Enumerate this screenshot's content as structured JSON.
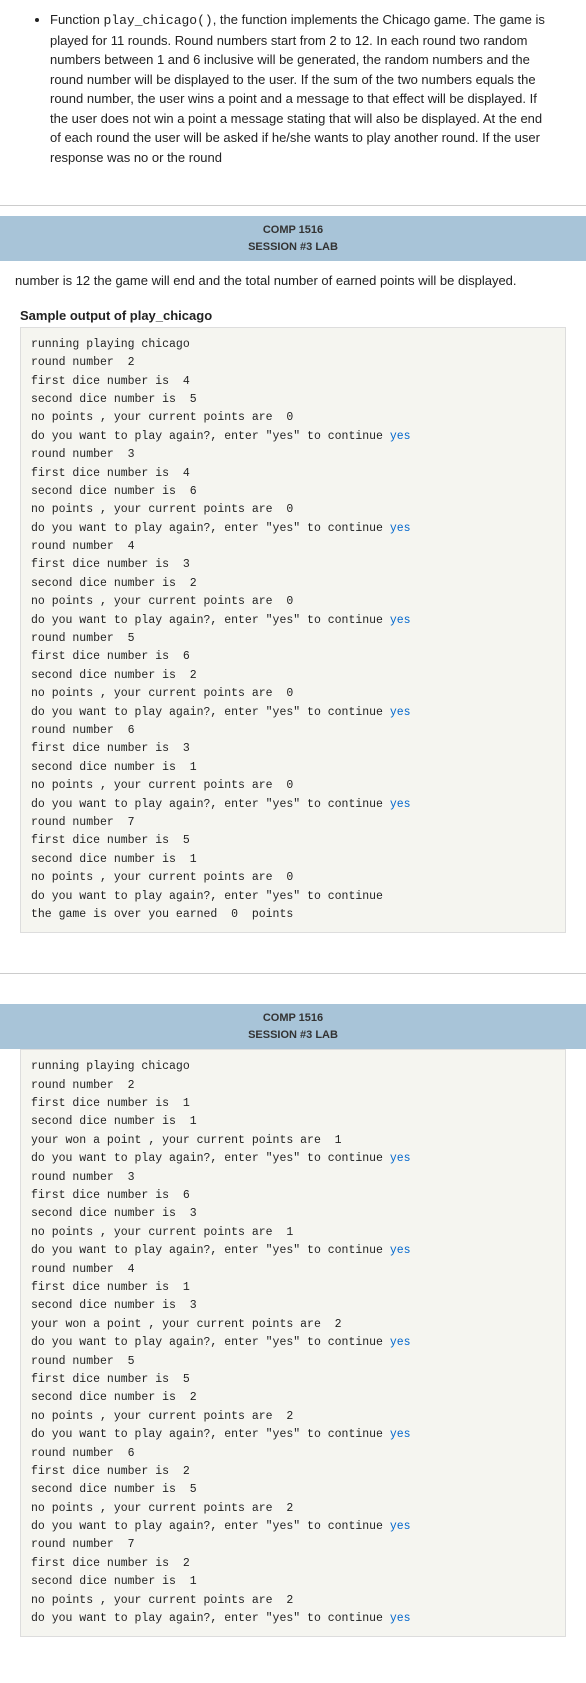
{
  "intro": {
    "bullet_text": "Function ",
    "function_name": "play_chicago()",
    "description": ", the function implements the Chicago game. The game is played for 11 rounds. Round numbers start from 2 to 12. In each round two random numbers between 1 and 6 inclusive will be generated, the random numbers and the round number will be displayed to the user. If the sum of the two numbers equals the round number, the user wins a point and a message to that effect will be displayed. If the user does not win a point a message stating that will also be displayed. At the end of each round the user will be asked if he/she wants to play another round. If the user response was no or the round"
  },
  "header1": {
    "line1": "COMP 1516",
    "line2": "SESSION #3 LAB"
  },
  "continuation": {
    "text": "number is 12 the game will end and the total number of earned points will be displayed."
  },
  "sample_label": "Sample output of play_chicago",
  "code_block1": {
    "lines": [
      {
        "text": "running playing chicago",
        "has_yes": false
      },
      {
        "text": "round number  2",
        "has_yes": false
      },
      {
        "text": "first dice number is  4",
        "has_yes": false
      },
      {
        "text": "second dice number is  5",
        "has_yes": false
      },
      {
        "text": "no points , your current points are  0",
        "has_yes": false
      },
      {
        "text": "do you want to play again?, enter \"yes\" to continue ",
        "has_yes": true,
        "yes_word": "yes"
      },
      {
        "text": "round number  3",
        "has_yes": false
      },
      {
        "text": "first dice number is  4",
        "has_yes": false
      },
      {
        "text": "second dice number is  6",
        "has_yes": false
      },
      {
        "text": "no points , your current points are  0",
        "has_yes": false
      },
      {
        "text": "do you want to play again?, enter \"yes\" to continue ",
        "has_yes": true,
        "yes_word": "yes"
      },
      {
        "text": "round number  4",
        "has_yes": false
      },
      {
        "text": "first dice number is  3",
        "has_yes": false
      },
      {
        "text": "second dice number is  2",
        "has_yes": false
      },
      {
        "text": "no points , your current points are  0",
        "has_yes": false
      },
      {
        "text": "do you want to play again?, enter \"yes\" to continue ",
        "has_yes": true,
        "yes_word": "yes"
      },
      {
        "text": "round number  5",
        "has_yes": false
      },
      {
        "text": "first dice number is  6",
        "has_yes": false
      },
      {
        "text": "second dice number is  2",
        "has_yes": false
      },
      {
        "text": "no points , your current points are  0",
        "has_yes": false
      },
      {
        "text": "do you want to play again?, enter \"yes\" to continue ",
        "has_yes": true,
        "yes_word": "yes"
      },
      {
        "text": "round number  6",
        "has_yes": false
      },
      {
        "text": "first dice number is  3",
        "has_yes": false
      },
      {
        "text": "second dice number is  1",
        "has_yes": false
      },
      {
        "text": "no points , your current points are  0",
        "has_yes": false
      },
      {
        "text": "do you want to play again?, enter \"yes\" to continue ",
        "has_yes": true,
        "yes_word": "yes"
      },
      {
        "text": "round number  7",
        "has_yes": false
      },
      {
        "text": "first dice number is  5",
        "has_yes": false
      },
      {
        "text": "second dice number is  1",
        "has_yes": false
      },
      {
        "text": "no points , your current points are  0",
        "has_yes": false
      },
      {
        "text": "do you want to play again?, enter \"yes\" to continue",
        "has_yes": false
      },
      {
        "text": "the game is over you earned  0  points",
        "has_yes": false
      }
    ]
  },
  "header2": {
    "line1": "COMP 1516",
    "line2": "SESSION #3 LAB"
  },
  "code_block2": {
    "lines": [
      {
        "text": "running playing chicago",
        "has_yes": false
      },
      {
        "text": "round number  2",
        "has_yes": false
      },
      {
        "text": "first dice number is  1",
        "has_yes": false
      },
      {
        "text": "second dice number is  1",
        "has_yes": false
      },
      {
        "text": "your won a point , your current points are  1",
        "has_yes": false
      },
      {
        "text": "do you want to play again?, enter \"yes\" to continue ",
        "has_yes": true,
        "yes_word": "yes"
      },
      {
        "text": "round number  3",
        "has_yes": false
      },
      {
        "text": "first dice number is  6",
        "has_yes": false
      },
      {
        "text": "second dice number is  3",
        "has_yes": false
      },
      {
        "text": "no points , your current points are  1",
        "has_yes": false
      },
      {
        "text": "do you want to play again?, enter \"yes\" to continue ",
        "has_yes": true,
        "yes_word": "yes"
      },
      {
        "text": "round number  4",
        "has_yes": false
      },
      {
        "text": "first dice number is  1",
        "has_yes": false
      },
      {
        "text": "second dice number is  3",
        "has_yes": false
      },
      {
        "text": "your won a point , your current points are  2",
        "has_yes": false
      },
      {
        "text": "do you want to play again?, enter \"yes\" to continue ",
        "has_yes": true,
        "yes_word": "yes"
      },
      {
        "text": "round number  5",
        "has_yes": false
      },
      {
        "text": "first dice number is  5",
        "has_yes": false
      },
      {
        "text": "second dice number is  2",
        "has_yes": false
      },
      {
        "text": "no points , your current points are  2",
        "has_yes": false
      },
      {
        "text": "do you want to play again?, enter \"yes\" to continue ",
        "has_yes": true,
        "yes_word": "yes"
      },
      {
        "text": "round number  6",
        "has_yes": false
      },
      {
        "text": "first dice number is  2",
        "has_yes": false
      },
      {
        "text": "second dice number is  5",
        "has_yes": false
      },
      {
        "text": "no points , your current points are  2",
        "has_yes": false
      },
      {
        "text": "do you want to play again?, enter \"yes\" to continue ",
        "has_yes": true,
        "yes_word": "yes"
      },
      {
        "text": "round number  7",
        "has_yes": false
      },
      {
        "text": "first dice number is  2",
        "has_yes": false
      },
      {
        "text": "second dice number is  1",
        "has_yes": false
      },
      {
        "text": "no points , your current points are  2",
        "has_yes": false
      },
      {
        "text": "do you want to play again?, enter \"yes\" to continue ",
        "has_yes": true,
        "yes_word": "yes"
      }
    ]
  }
}
